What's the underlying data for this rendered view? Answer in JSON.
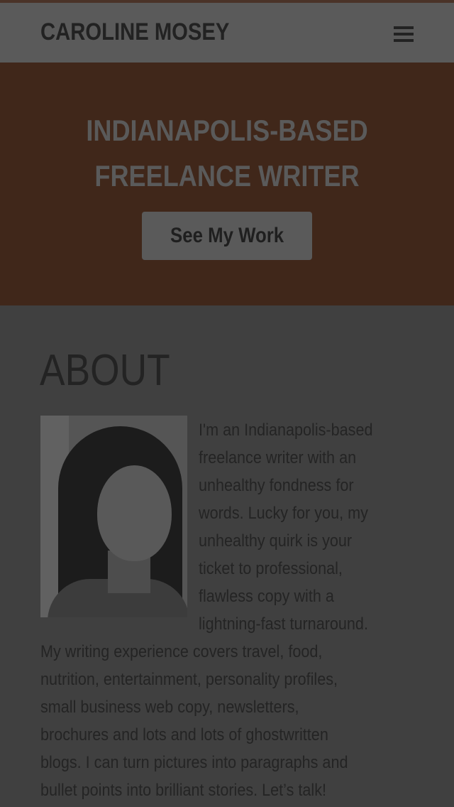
{
  "header": {
    "site_name": "CAROLINE MOSEY",
    "menu_icon": "hamburger-menu-icon"
  },
  "hero": {
    "line1": "INDIANAPOLIS-BASED",
    "line2": "FREELANCE WRITER",
    "cta_label": "See My Work"
  },
  "about": {
    "heading": "ABOUT",
    "photo_alt": "Caroline Mosey portrait",
    "lines": [
      "I'm an Indianapolis-based",
      "freelance writer with an",
      "unhealthy fondness for",
      "words. Lucky for you, my",
      "unhealthy quirk is your",
      "ticket to professional,",
      "flawless  copy with a",
      "lightning-fast turnaround.",
      "My writing experience covers travel, food,",
      "nutrition, entertainment, personality profiles,",
      "small business web copy, newsletters,",
      "brochures and lots and lots of ghostwritten",
      "blogs. I can turn pictures into paragraphs and",
      "bullet points into brilliant stories. Let’s talk!"
    ]
  },
  "colors": {
    "hero_bg": "#40271a",
    "header_bg": "#5a5a5a",
    "content_bg": "#404040"
  }
}
